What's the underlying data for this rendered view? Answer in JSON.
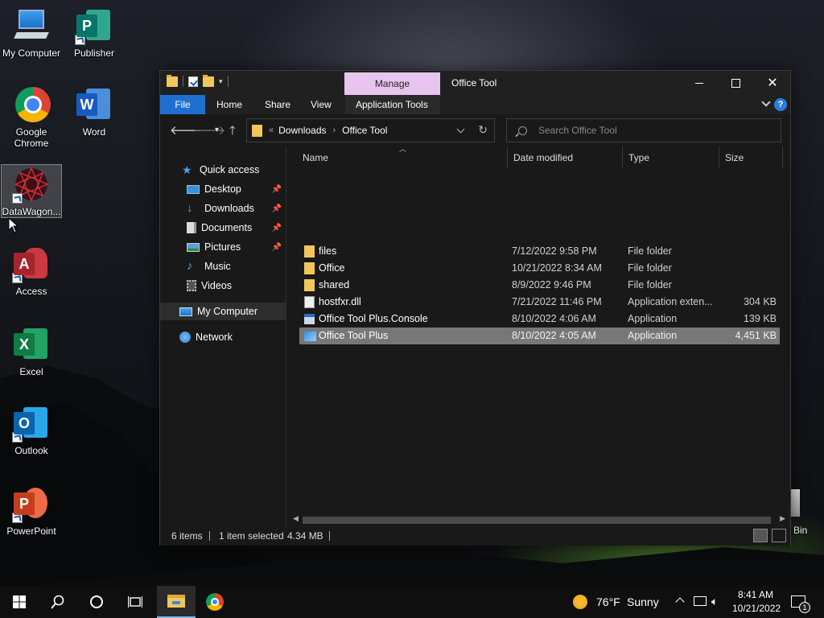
{
  "desktop": {
    "icons": [
      {
        "label": "My Computer"
      },
      {
        "label": "Publisher"
      },
      {
        "label": "Google Chrome"
      },
      {
        "label": "Word"
      },
      {
        "label": "DataWagon..."
      },
      {
        "label": "Access"
      },
      {
        "label": "Excel"
      },
      {
        "label": "Outlook"
      },
      {
        "label": "PowerPoint"
      },
      {
        "label": "Bin"
      }
    ]
  },
  "window": {
    "title": "Office Tool",
    "manage_tab": "Manage",
    "ribbon_tabs": [
      "File",
      "Home",
      "Share",
      "View",
      "Application Tools"
    ],
    "help": "?",
    "breadcrumb": {
      "overflow": "«",
      "items": [
        "Downloads",
        "Office Tool"
      ],
      "separator": "›"
    },
    "search_placeholder": "Search Office Tool",
    "nav": {
      "items": [
        {
          "label": "Quick access",
          "icon": "star-icon"
        },
        {
          "label": "Desktop",
          "icon": "desktop-icon",
          "pinned": true
        },
        {
          "label": "Downloads",
          "icon": "download-icon",
          "pinned": true
        },
        {
          "label": "Documents",
          "icon": "documents-icon",
          "pinned": true
        },
        {
          "label": "Pictures",
          "icon": "pictures-icon",
          "pinned": true
        },
        {
          "label": "Music",
          "icon": "music-icon"
        },
        {
          "label": "Videos",
          "icon": "videos-icon"
        },
        {
          "label": "My Computer",
          "icon": "computer-icon",
          "selected": true
        },
        {
          "label": "Network",
          "icon": "network-icon"
        }
      ]
    },
    "columns": [
      "Name",
      "Date modified",
      "Type",
      "Size"
    ],
    "files": [
      {
        "name": "files",
        "date": "7/12/2022 9:58 PM",
        "type": "File folder",
        "size": "",
        "icon": "folder-icon"
      },
      {
        "name": "Office",
        "date": "10/21/2022 8:34 AM",
        "type": "File folder",
        "size": "",
        "icon": "folder-icon"
      },
      {
        "name": "shared",
        "date": "8/9/2022 9:46 PM",
        "type": "File folder",
        "size": "",
        "icon": "folder-icon"
      },
      {
        "name": "hostfxr.dll",
        "date": "7/21/2022 11:46 PM",
        "type": "Application exten...",
        "size": "304 KB",
        "icon": "dll-icon"
      },
      {
        "name": "Office Tool Plus.Console",
        "date": "8/10/2022 4:06 AM",
        "type": "Application",
        "size": "139 KB",
        "icon": "console-app-icon"
      },
      {
        "name": "Office Tool Plus",
        "date": "8/10/2022 4:05 AM",
        "type": "Application",
        "size": "4,451 KB",
        "icon": "app-icon",
        "selected": true
      }
    ],
    "status": {
      "items": "6 items",
      "selected": "1 item selected",
      "size": "4.34 MB"
    }
  },
  "taskbar": {
    "weather_temp": "76°F",
    "weather_desc": "Sunny",
    "time": "8:41 AM",
    "date": "10/21/2022",
    "notification_count": "1"
  },
  "colors": {
    "file_tab": "#1f6fd1",
    "manage_tab": "#e8c5ee",
    "selected_row": "#777777",
    "window_bg": "#191919"
  }
}
